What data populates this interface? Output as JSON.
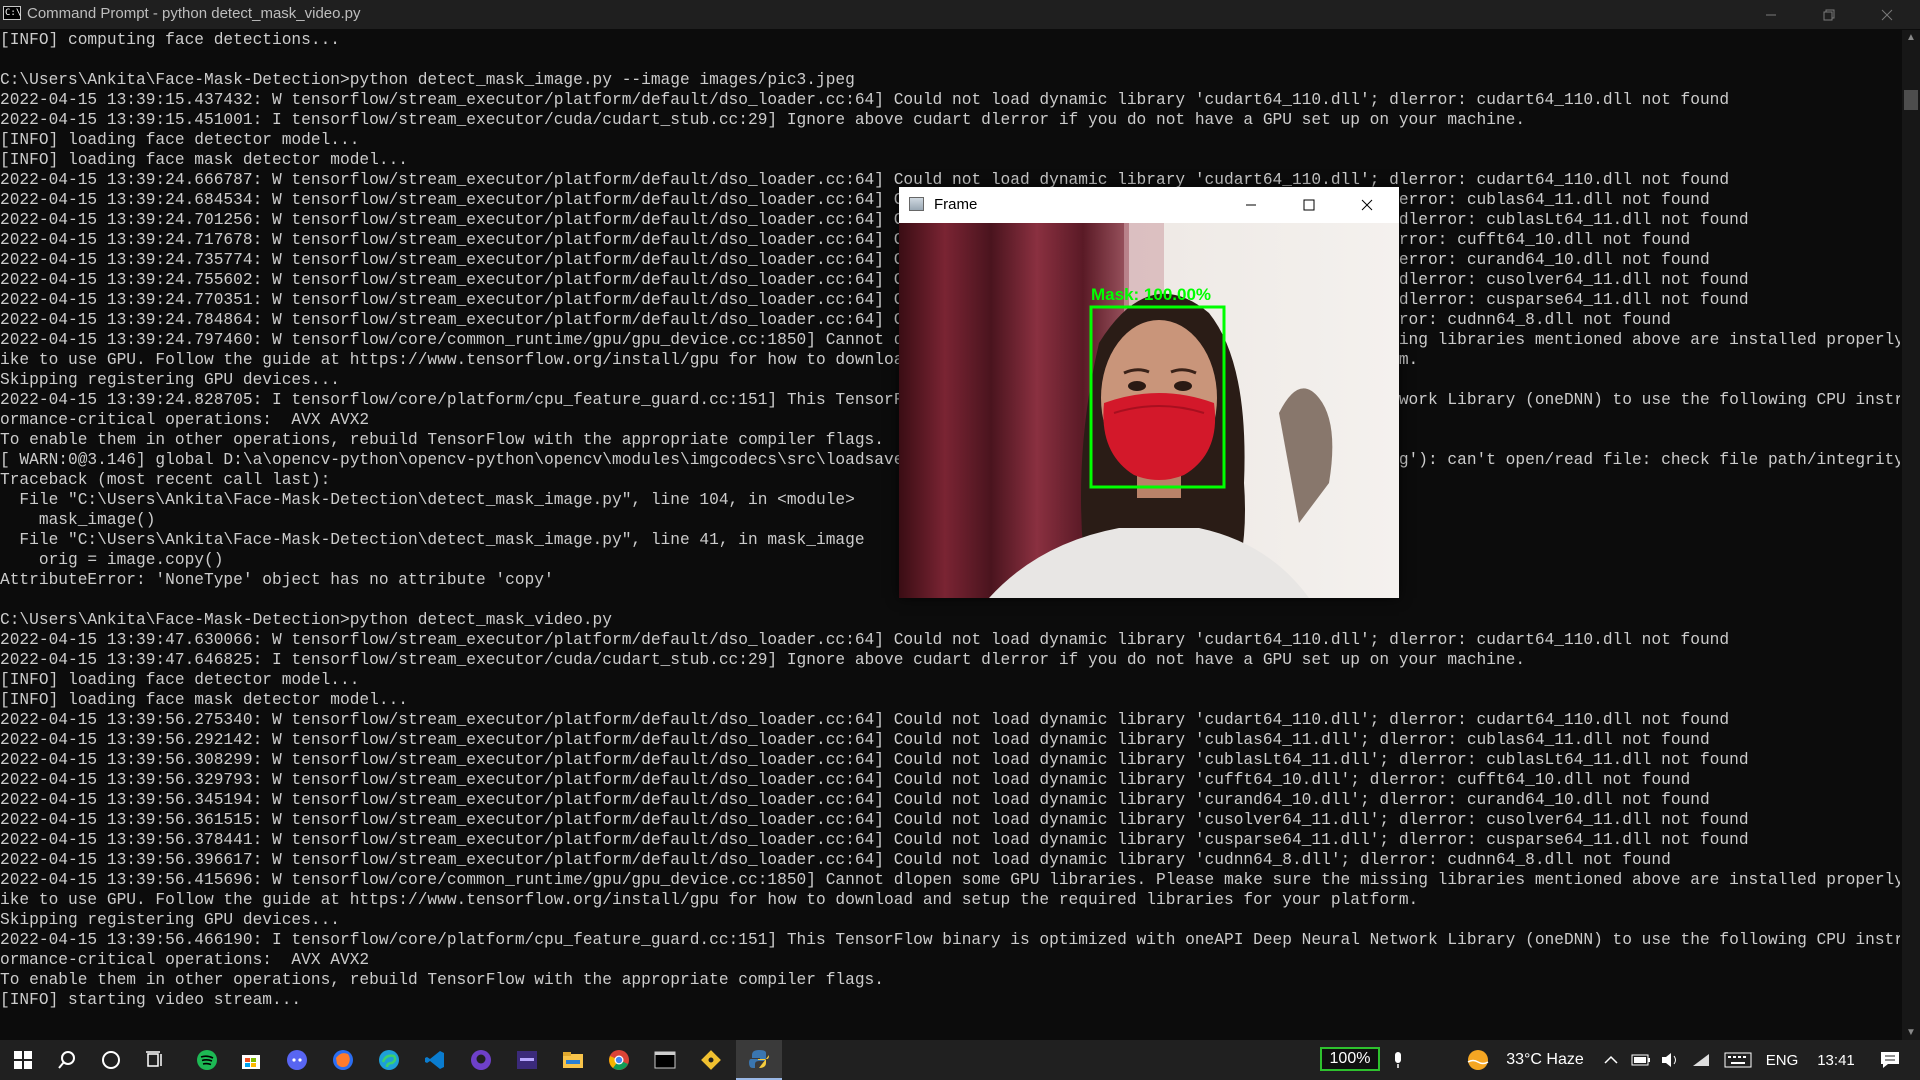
{
  "window": {
    "title": "Command Prompt - python  detect_mask_video.py",
    "app_icon_text": "C:\\"
  },
  "console": {
    "lines": [
      "[INFO] computing face detections...",
      "",
      "C:\\Users\\Ankita\\Face-Mask-Detection>python detect_mask_image.py --image images/pic3.jpeg",
      "2022-04-15 13:39:15.437432: W tensorflow/stream_executor/platform/default/dso_loader.cc:64] Could not load dynamic library 'cudart64_110.dll'; dlerror: cudart64_110.dll not found",
      "2022-04-15 13:39:15.451001: I tensorflow/stream_executor/cuda/cudart_stub.cc:29] Ignore above cudart dlerror if you do not have a GPU set up on your machine.",
      "[INFO] loading face detector model...",
      "[INFO] loading face mask detector model...",
      "2022-04-15 13:39:24.666787: W tensorflow/stream_executor/platform/default/dso_loader.cc:64] Could not load dynamic library 'cudart64_110.dll'; dlerror: cudart64_110.dll not found",
      "2022-04-15 13:39:24.684534: W tensorflow/stream_executor/platform/default/dso_loader.cc:64] Could not load dynamic library 'cublas64_11.dll'; dlerror: cublas64_11.dll not found",
      "2022-04-15 13:39:24.701256: W tensorflow/stream_executor/platform/default/dso_loader.cc:64] Could not load dynamic library 'cublasLt64_11.dll'; dlerror: cublasLt64_11.dll not found",
      "2022-04-15 13:39:24.717678: W tensorflow/stream_executor/platform/default/dso_loader.cc:64] Could not load dynamic library 'cufft64_10.dll'; dlerror: cufft64_10.dll not found",
      "2022-04-15 13:39:24.735774: W tensorflow/stream_executor/platform/default/dso_loader.cc:64] Could not load dynamic library 'curand64_10.dll'; dlerror: curand64_10.dll not found",
      "2022-04-15 13:39:24.755602: W tensorflow/stream_executor/platform/default/dso_loader.cc:64] Could not load dynamic library 'cusolver64_11.dll'; dlerror: cusolver64_11.dll not found",
      "2022-04-15 13:39:24.770351: W tensorflow/stream_executor/platform/default/dso_loader.cc:64] Could not load dynamic library 'cusparse64_11.dll'; dlerror: cusparse64_11.dll not found",
      "2022-04-15 13:39:24.784864: W tensorflow/stream_executor/platform/default/dso_loader.cc:64] Could not load dynamic library 'cudnn64_8.dll'; dlerror: cudnn64_8.dll not found",
      "2022-04-15 13:39:24.797460: W tensorflow/core/common_runtime/gpu/gpu_device.cc:1850] Cannot dlopen some GPU libraries. Please make sure the missing libraries mentioned above are installed properly if you would l",
      "ike to use GPU. Follow the guide at https://www.tensorflow.org/install/gpu for how to download and setup the required libraries for your platform.",
      "Skipping registering GPU devices...",
      "2022-04-15 13:39:24.828705: I tensorflow/core/platform/cpu_feature_guard.cc:151] This TensorFlow binary is optimized with oneAPI Deep Neural Network Library (oneDNN) to use the following CPU instructions in perf",
      "ormance-critical operations:  AVX AVX2",
      "To enable them in other operations, rebuild TensorFlow with the appropriate compiler flags.",
      "[ WARN:0@3.146] global D:\\a\\opencv-python\\opencv-python\\opencv\\modules\\imgcodecs\\src\\loadsave.cpp (239) cv::findDecoder imread_('images/pic3.jpeg'): can't open/read file: check file path/integrity",
      "Traceback (most recent call last):",
      "  File \"C:\\Users\\Ankita\\Face-Mask-Detection\\detect_mask_image.py\", line 104, in <module>",
      "    mask_image()",
      "  File \"C:\\Users\\Ankita\\Face-Mask-Detection\\detect_mask_image.py\", line 41, in mask_image",
      "    orig = image.copy()",
      "AttributeError: 'NoneType' object has no attribute 'copy'",
      "",
      "C:\\Users\\Ankita\\Face-Mask-Detection>python detect_mask_video.py",
      "2022-04-15 13:39:47.630066: W tensorflow/stream_executor/platform/default/dso_loader.cc:64] Could not load dynamic library 'cudart64_110.dll'; dlerror: cudart64_110.dll not found",
      "2022-04-15 13:39:47.646825: I tensorflow/stream_executor/cuda/cudart_stub.cc:29] Ignore above cudart dlerror if you do not have a GPU set up on your machine.",
      "[INFO] loading face detector model...",
      "[INFO] loading face mask detector model...",
      "2022-04-15 13:39:56.275340: W tensorflow/stream_executor/platform/default/dso_loader.cc:64] Could not load dynamic library 'cudart64_110.dll'; dlerror: cudart64_110.dll not found",
      "2022-04-15 13:39:56.292142: W tensorflow/stream_executor/platform/default/dso_loader.cc:64] Could not load dynamic library 'cublas64_11.dll'; dlerror: cublas64_11.dll not found",
      "2022-04-15 13:39:56.308299: W tensorflow/stream_executor/platform/default/dso_loader.cc:64] Could not load dynamic library 'cublasLt64_11.dll'; dlerror: cublasLt64_11.dll not found",
      "2022-04-15 13:39:56.329793: W tensorflow/stream_executor/platform/default/dso_loader.cc:64] Could not load dynamic library 'cufft64_10.dll'; dlerror: cufft64_10.dll not found",
      "2022-04-15 13:39:56.345194: W tensorflow/stream_executor/platform/default/dso_loader.cc:64] Could not load dynamic library 'curand64_10.dll'; dlerror: curand64_10.dll not found",
      "2022-04-15 13:39:56.361515: W tensorflow/stream_executor/platform/default/dso_loader.cc:64] Could not load dynamic library 'cusolver64_11.dll'; dlerror: cusolver64_11.dll not found",
      "2022-04-15 13:39:56.378441: W tensorflow/stream_executor/platform/default/dso_loader.cc:64] Could not load dynamic library 'cusparse64_11.dll'; dlerror: cusparse64_11.dll not found",
      "2022-04-15 13:39:56.396617: W tensorflow/stream_executor/platform/default/dso_loader.cc:64] Could not load dynamic library 'cudnn64_8.dll'; dlerror: cudnn64_8.dll not found",
      "2022-04-15 13:39:56.415696: W tensorflow/core/common_runtime/gpu/gpu_device.cc:1850] Cannot dlopen some GPU libraries. Please make sure the missing libraries mentioned above are installed properly if you would l",
      "ike to use GPU. Follow the guide at https://www.tensorflow.org/install/gpu for how to download and setup the required libraries for your platform.",
      "Skipping registering GPU devices...",
      "2022-04-15 13:39:56.466190: I tensorflow/core/platform/cpu_feature_guard.cc:151] This TensorFlow binary is optimized with oneAPI Deep Neural Network Library (oneDNN) to use the following CPU instructions in perf",
      "ormance-critical operations:  AVX AVX2",
      "To enable them in other operations, rebuild TensorFlow with the appropriate compiler flags.",
      "[INFO] starting video stream..."
    ]
  },
  "frame_window": {
    "title": "Frame",
    "detection_label": "Mask: 100.00%",
    "detection_color": "#00ff00"
  },
  "taskbar": {
    "battery_percent": "100%",
    "weather": "33°C  Haze",
    "language": "ENG",
    "time": "13:41",
    "pinned_apps": [
      "start-icon",
      "search-icon",
      "cortana-icon",
      "task-view-icon",
      "spotify-icon",
      "store-icon",
      "discord-icon",
      "firefox-icon",
      "edge-icon",
      "vscode-icon",
      "github-icon",
      "music-app-icon",
      "file-explorer-icon",
      "chrome-icon",
      "terminal-icon",
      "git-icon",
      "python-icon"
    ]
  },
  "colors": {
    "console_bg": "#0c0c0c",
    "console_text": "#cccccc",
    "taskbar_bg": "#202020",
    "battery_border": "#2ec12e"
  }
}
